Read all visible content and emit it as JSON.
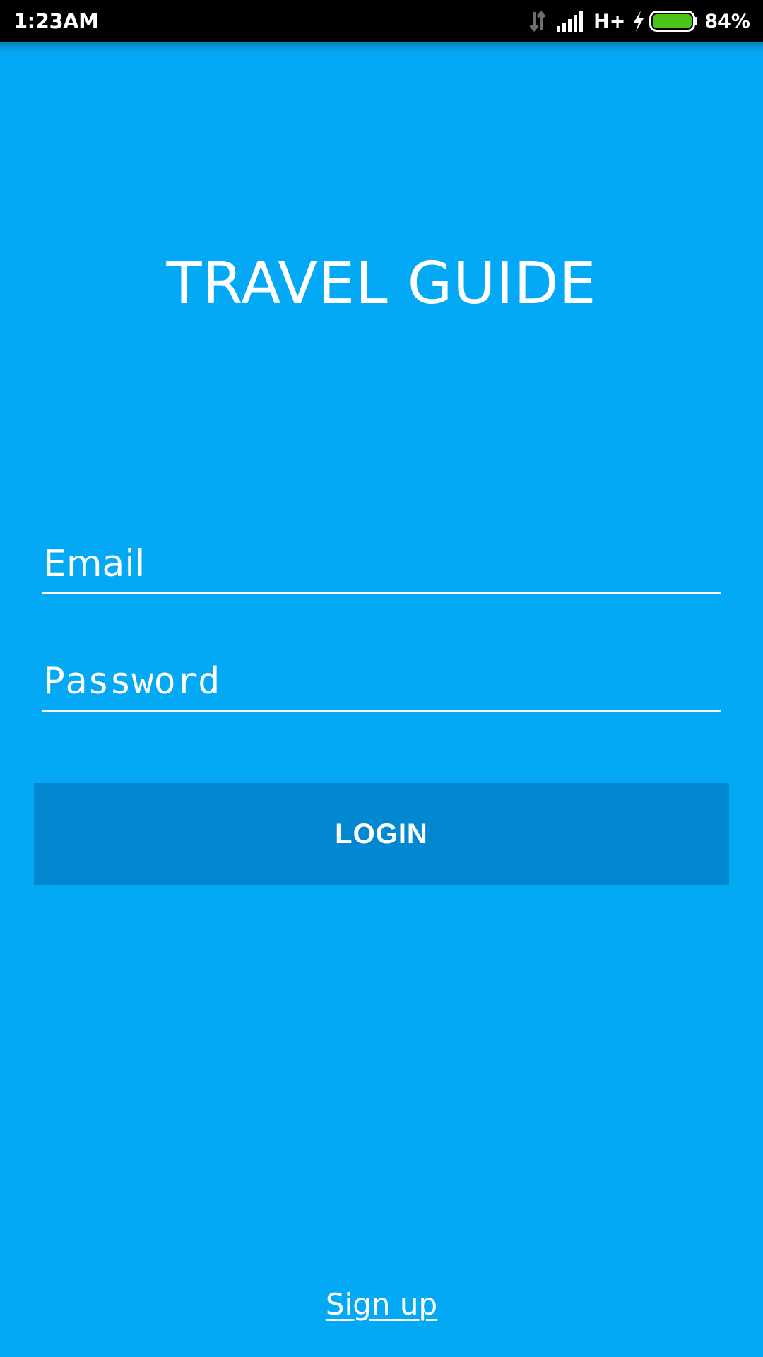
{
  "status_bar": {
    "time": "1:23AM",
    "network_type": "H+",
    "battery_percent": "84%",
    "battery_level": 0.84,
    "battery_color": "#4CC417",
    "icons": [
      "data-transfer-icon",
      "signal-icon",
      "charging-bolt-icon",
      "battery-icon"
    ]
  },
  "app": {
    "title": "TRAVEL GUIDE",
    "background_color": "#03A9F4",
    "button_color": "#0288D1"
  },
  "login_form": {
    "email": {
      "placeholder": "Email",
      "value": ""
    },
    "password": {
      "placeholder": "Password",
      "value": ""
    },
    "login_label": "LOGIN"
  },
  "footer": {
    "signup_label": "Sign up"
  }
}
